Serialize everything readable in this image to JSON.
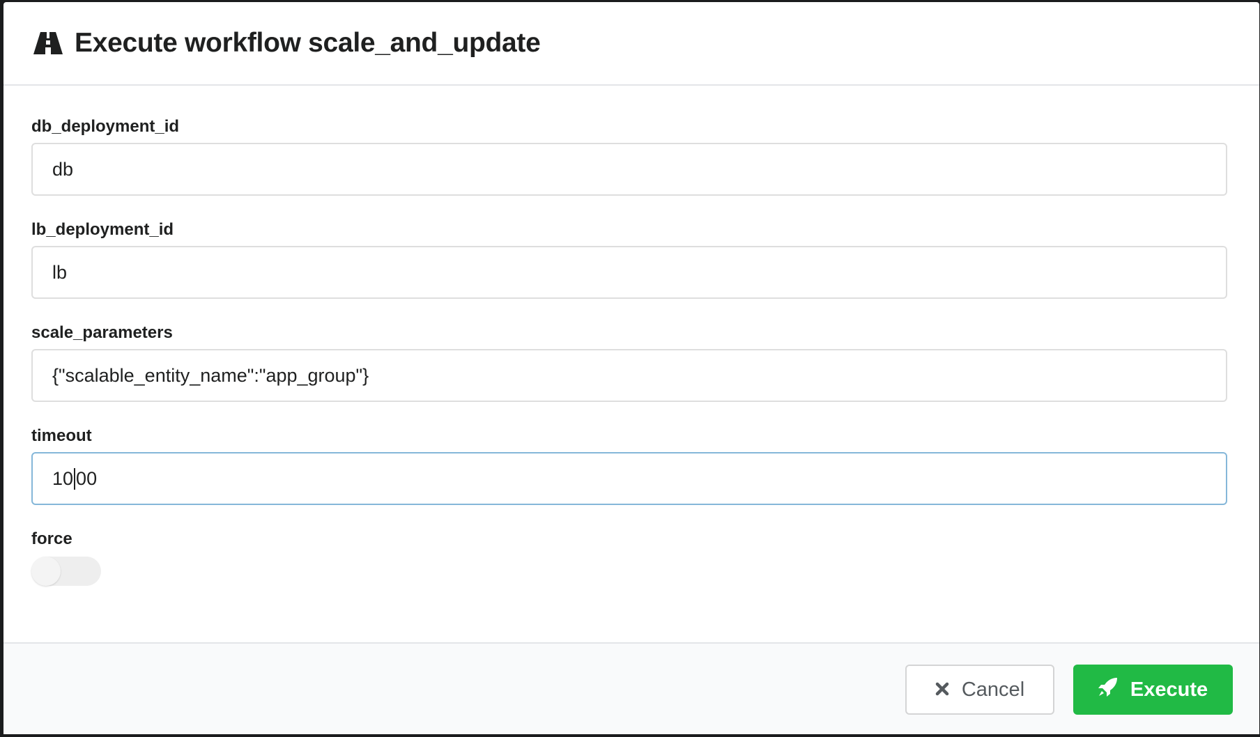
{
  "modal": {
    "title": "Execute workflow scale_and_update",
    "header_icon": "road-icon"
  },
  "fields": [
    {
      "label": "db_deployment_id",
      "value": "db"
    },
    {
      "label": "lb_deployment_id",
      "value": "lb"
    },
    {
      "label": "scale_parameters",
      "value": "{\"scalable_entity_name\":\"app_group\"}"
    },
    {
      "label": "timeout",
      "value_before_caret": "10",
      "value_after_caret": "00"
    },
    {
      "label": "force",
      "toggle_on": false
    }
  ],
  "actions": {
    "cancel_label": "Cancel",
    "cancel_icon": "close-icon",
    "execute_label": "Execute",
    "execute_icon": "rocket-icon"
  },
  "colors": {
    "execute_green": "#21ba45",
    "focus_border": "#85b7d9"
  }
}
